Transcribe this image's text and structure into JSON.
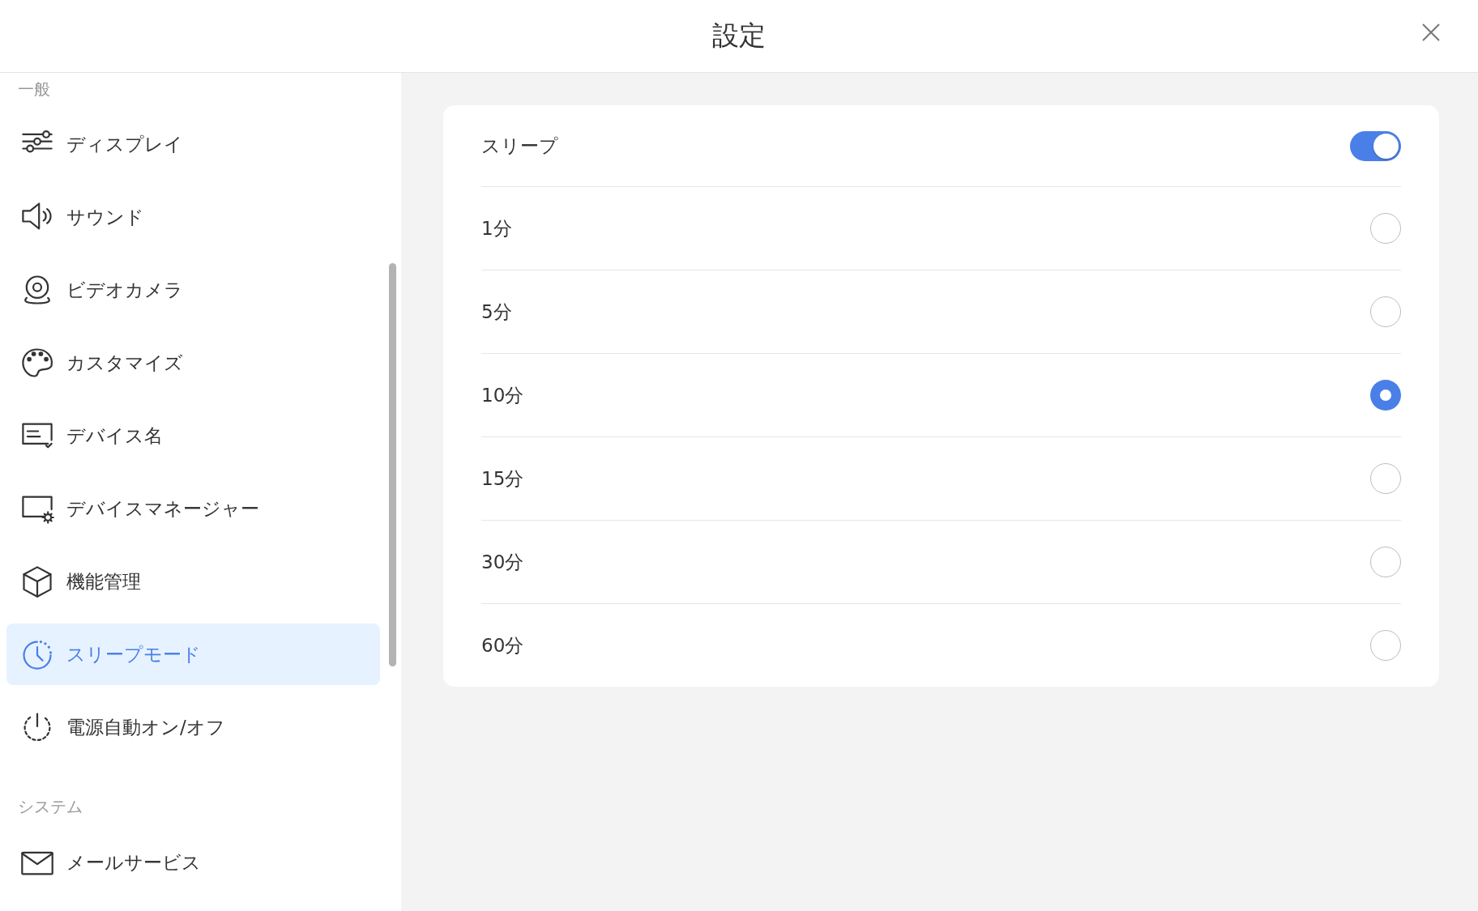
{
  "window": {
    "title": "設定"
  },
  "sidebar": {
    "sections": [
      {
        "label": "一般",
        "items": [
          {
            "label": "ディスプレイ",
            "selected": false
          },
          {
            "label": "サウンド",
            "selected": false
          },
          {
            "label": "ビデオカメラ",
            "selected": false
          },
          {
            "label": "カスタマイズ",
            "selected": false
          },
          {
            "label": "デバイス名",
            "selected": false
          },
          {
            "label": "デバイスマネージャー",
            "selected": false
          },
          {
            "label": "機能管理",
            "selected": false
          },
          {
            "label": "スリープモード",
            "selected": true
          },
          {
            "label": "電源自動オン/オフ",
            "selected": false
          }
        ]
      },
      {
        "label": "システム",
        "items": [
          {
            "label": "メールサービス",
            "selected": false
          }
        ]
      }
    ]
  },
  "panel": {
    "toggle": {
      "label": "スリープ",
      "on": true
    },
    "options": [
      {
        "label": "1分",
        "selected": false
      },
      {
        "label": "5分",
        "selected": false
      },
      {
        "label": "10分",
        "selected": true
      },
      {
        "label": "15分",
        "selected": false
      },
      {
        "label": "30分",
        "selected": false
      },
      {
        "label": "60分",
        "selected": false
      }
    ]
  }
}
